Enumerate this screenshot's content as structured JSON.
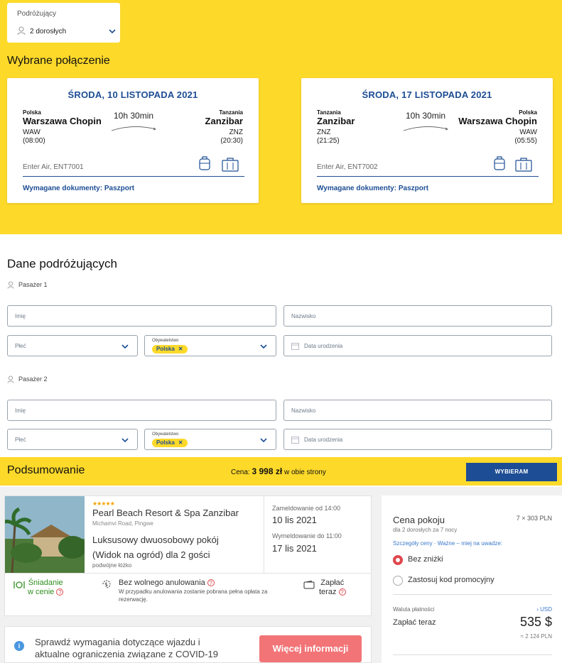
{
  "travelers": {
    "label": "Podróżujący",
    "value": "2 dorosłych"
  },
  "selected_title": "Wybrane połączenie",
  "outbound": {
    "date": "ŚRODA, 10 LISTOPADA 2021",
    "from": {
      "country": "Polska",
      "city": "Warszawa Chopin",
      "code": "WAW",
      "time": "(08:00)"
    },
    "to": {
      "country": "Tanzania",
      "city": "Zanzibar",
      "code": "ZNZ",
      "time": "(20:30)"
    },
    "duration": "10h 30min",
    "flight": "Enter Air, ENT7001",
    "docs": "Wymagane dokumenty: Paszport"
  },
  "return": {
    "date": "ŚRODA, 17 LISTOPADA 2021",
    "from": {
      "country": "Tanzania",
      "city": "Zanzibar",
      "code": "ZNZ",
      "time": "(21:25)"
    },
    "to": {
      "country": "Polska",
      "city": "Warszawa Chopin",
      "code": "WAW",
      "time": "(05:55)"
    },
    "duration": "10h 30min",
    "flight": "Enter Air, ENT7002",
    "docs": "Wymagane dokumenty: Paszport"
  },
  "passengers_title": "Dane podróżujących",
  "passengers": [
    {
      "label": "Pasażer 1",
      "first_name_ph": "Imię",
      "last_name_ph": "Nazwisko",
      "gender_ph": "Płeć",
      "citizenship_label": "Obywatelstwo",
      "citizenship_value": "Polska",
      "birthdate_ph": "Data urodzenia"
    },
    {
      "label": "Pasażer 2",
      "first_name_ph": "Imię",
      "last_name_ph": "Nazwisko",
      "gender_ph": "Płeć",
      "citizenship_label": "Obywatelstwo",
      "citizenship_value": "Polska",
      "birthdate_ph": "Data urodzenia"
    }
  ],
  "summary": {
    "title": "Podsumowanie",
    "price_prefix": "Cena:",
    "price": "3 998 zł",
    "price_suffix": "w obie strony",
    "button": "WYBIERAM"
  },
  "hotel": {
    "stars": "★★★★★",
    "name": "Pearl Beach Resort & Spa Zanzibar",
    "address": "Michamvi Road, Pingwe",
    "room": "Luksusowy dwuosobowy pokój (Widok na ogród) dla 2 gości",
    "bed": "podwójne łóżko",
    "checkin_label": "Zameldowanie od 14:00",
    "checkin_date": "10 lis 2021",
    "checkout_label": "Wymeldowanie do 11:00",
    "checkout_date": "17 lis 2021",
    "breakfast_line1": "Śniadanie",
    "breakfast_line2": "w cenie",
    "cancel_title": "Bez wolnego anulowania",
    "cancel_desc": "W przypadku anulowania zostanie pobrana pełna opłata za rezerwację.",
    "pay_line1": "Zapłać",
    "pay_line2": "teraz"
  },
  "covid": {
    "text_line1": "Sprawdź wymagania dotyczące wjazdu i",
    "text_line2": "aktualne ograniczenia związane z COVID-19",
    "button": "Więcej informacji"
  },
  "price_card": {
    "title": "Cena pokoju",
    "multiplier": "7 × 303 PLN",
    "sub": "dla 2 dorosłych  za 7 nocy",
    "links": "Szczegóły ceny · Ważne – miej na uwadze:",
    "option1": "Bez zniżki",
    "option2": "Zastosuj kod promocyjny",
    "currency_label": "Waluta płatności",
    "currency_link": "› USD",
    "pay_label": "Zapłać teraz",
    "amount": "535 $",
    "amount_pln": "≈ 2 124 PLN"
  },
  "colors": {
    "brand_yellow": "#fdd92a",
    "brand_blue": "#1d4d94",
    "accent_red": "#e0474c",
    "cta_pink": "#f27477"
  }
}
